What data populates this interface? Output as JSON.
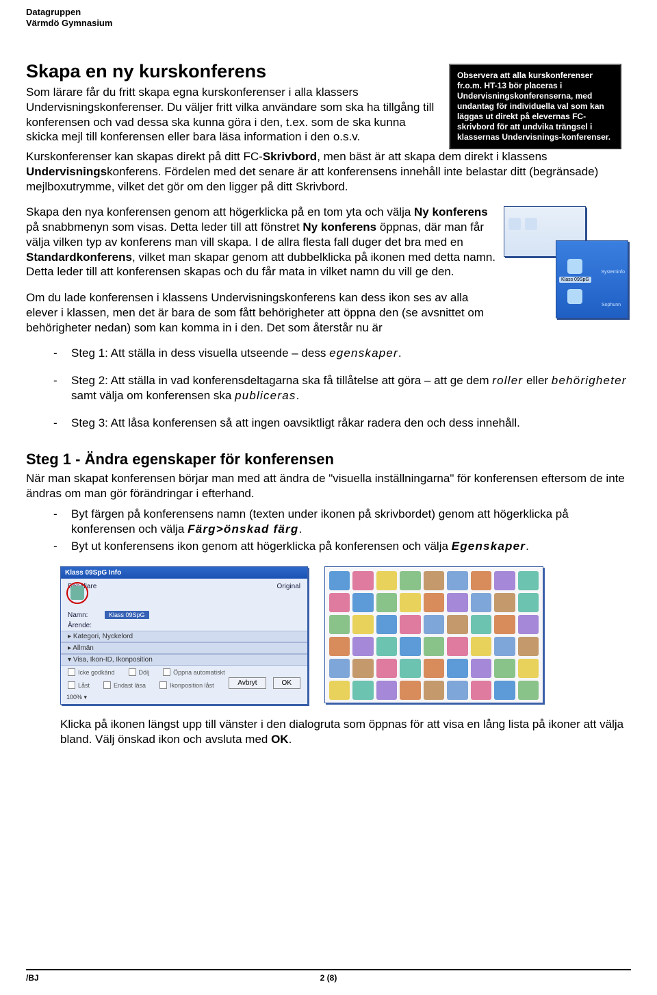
{
  "header": {
    "line1": "Datagruppen",
    "line2": "Värmdö Gymnasium"
  },
  "title": "Skapa en ny kurskonferens",
  "intro": "Som lärare får du fritt skapa egna kurskonferenser i alla klassers Undervisningskonferenser. Du väljer fritt vilka användare som ska ha tillgång till konferensen och vad dessa ska kunna göra i den, t.ex. som de ska kunna skicka mejl till konferensen eller bara läsa information i den o.s.v.",
  "note": "Observera att alla kurskonferenser fr.o.m. HT-13 bör placeras i Undervisningskonferenserna, med undantag för individuella val som kan läggas ut direkt på elevernas FC-skrivbord för att undvika trängsel i klassernas Undervisnings-konferenser.",
  "para2_pre": "Kurskonferenser kan skapas direkt på ditt FC-",
  "para2_b1": "Skrivbord",
  "para2_mid": ", men bäst är att skapa dem direkt i klassens ",
  "para2_b2": "Undervisnings",
  "para2_post": "konferens. Fördelen med det senare är att konferensens innehåll inte belastar ditt (begränsade) mejlboxutrymme, vilket det gör om den ligger på ditt Skrivbord.",
  "para3_a": "Skapa den nya konferensen genom att högerklicka på en tom yta och välja ",
  "para3_b1": "Ny konferens",
  "para3_b": " på snabbmenyn som visas. Detta leder till att fönstret ",
  "para3_b2": "Ny konferens",
  "para3_c": " öppnas, där man får välja vilken typ av konferens man vill skapa. I de allra flesta fall duger det bra med en ",
  "para3_b3": "Standardkonferens",
  "para3_d": ", vilket man skapar genom att dubbelklicka på ikonen med detta namn. Detta leder till att konferensen skapas och du får mata in vilket namn du vill ge den.",
  "para4": "Om du lade konferensen i klassens Undervisningskonferens kan dess ikon ses av alla elever i klassen, men det är bara de som fått behörigheter att öppna den (se avsnittet om behörigheter nedan) som kan komma in i den. Det som återstår nu är",
  "steps": [
    {
      "pre": "Steg 1: Att ställa in dess visuella utseende – dess ",
      "it": "egenskaper",
      "post": "."
    },
    {
      "pre": "Steg 2: Att ställa in vad konferensdeltagarna ska få tillåtelse att göra – att ge dem ",
      "it": "roller",
      "mid": " eller ",
      "it2": "behörigheter",
      "mid2": " samt välja om konferensen ska ",
      "it3": "publiceras",
      "post": "."
    },
    {
      "pre": "Steg 3: Att låsa konferensen så att ingen oavsiktligt råkar radera den och dess innehåll.",
      "it": "",
      "post": ""
    }
  ],
  "sub1_title": "Steg 1 - Ändra egenskaper för konferensen",
  "sub1_intro": "När man skapat konferensen börjar man med att ändra de \"visuella inställningarna\" för konferensen eftersom de inte ändras om man gör förändringar i efterhand.",
  "sub1_items": [
    {
      "a": "Byt färgen på konferensens namn (texten under ikonen på skrivbordet) genom att högerklicka på konferensen och välja ",
      "b": "Färg>önskad färg",
      "c": "."
    },
    {
      "a": "Byt ut konferensens ikon genom att högerklicka på konferensen och välja ",
      "b": "Egenskaper",
      "c": "."
    }
  ],
  "dialog": {
    "title": "Klass 09SpG Info",
    "behallare": "Behállare",
    "original": "Original",
    "namn_label": "Namn:",
    "namn_value": "Klass 09SpG",
    "arende": "Ärende:",
    "sect1": "Kategori, Nyckelord",
    "sect2": "Allmän",
    "sect3": "Visa, Ikon-ID, Ikonposition",
    "chk1": "Icke godkänd",
    "chk2": "Dölj",
    "chk3": "Öppna automatiskt",
    "chk4": "Låst",
    "chk5": "Endast läsa",
    "chk6": "Ikonposition låst",
    "btn_cancel": "Avbryt",
    "btn_ok": "OK",
    "zoom": "100%"
  },
  "mw2": {
    "label": "Klass 09SpG",
    "sys": "Systeminfo",
    "sap": "Sophunn"
  },
  "closing_a": "Klicka på ikonen längst upp till vänster i den dialogruta som öppnas för att visa en lång lista på ikoner att välja bland. Välj önskad ikon och avsluta med ",
  "closing_b": "OK",
  "closing_c": ".",
  "footer": {
    "left": "/BJ",
    "center": "2 (8)"
  },
  "icon_colors": [
    "#5c9bd8",
    "#e07ba0",
    "#e8d25c",
    "#8ac38a",
    "#c49a6c",
    "#7fa6d8",
    "#d88c5c",
    "#a688d8",
    "#6cc3b0",
    "#e07ba0",
    "#5c9bd8",
    "#8ac38a",
    "#e8d25c",
    "#d88c5c",
    "#a688d8",
    "#7fa6d8",
    "#c49a6c",
    "#6cc3b0",
    "#8ac38a",
    "#e8d25c",
    "#5c9bd8",
    "#e07ba0",
    "#7fa6d8",
    "#c49a6c",
    "#6cc3b0",
    "#d88c5c",
    "#a688d8",
    "#d88c5c",
    "#a688d8",
    "#6cc3b0",
    "#5c9bd8",
    "#8ac38a",
    "#e07ba0",
    "#e8d25c",
    "#7fa6d8",
    "#c49a6c",
    "#7fa6d8",
    "#c49a6c",
    "#e07ba0",
    "#6cc3b0",
    "#d88c5c",
    "#5c9bd8",
    "#a688d8",
    "#8ac38a",
    "#e8d25c",
    "#e8d25c",
    "#6cc3b0",
    "#a688d8",
    "#d88c5c",
    "#c49a6c",
    "#7fa6d8",
    "#e07ba0",
    "#5c9bd8",
    "#8ac38a"
  ]
}
